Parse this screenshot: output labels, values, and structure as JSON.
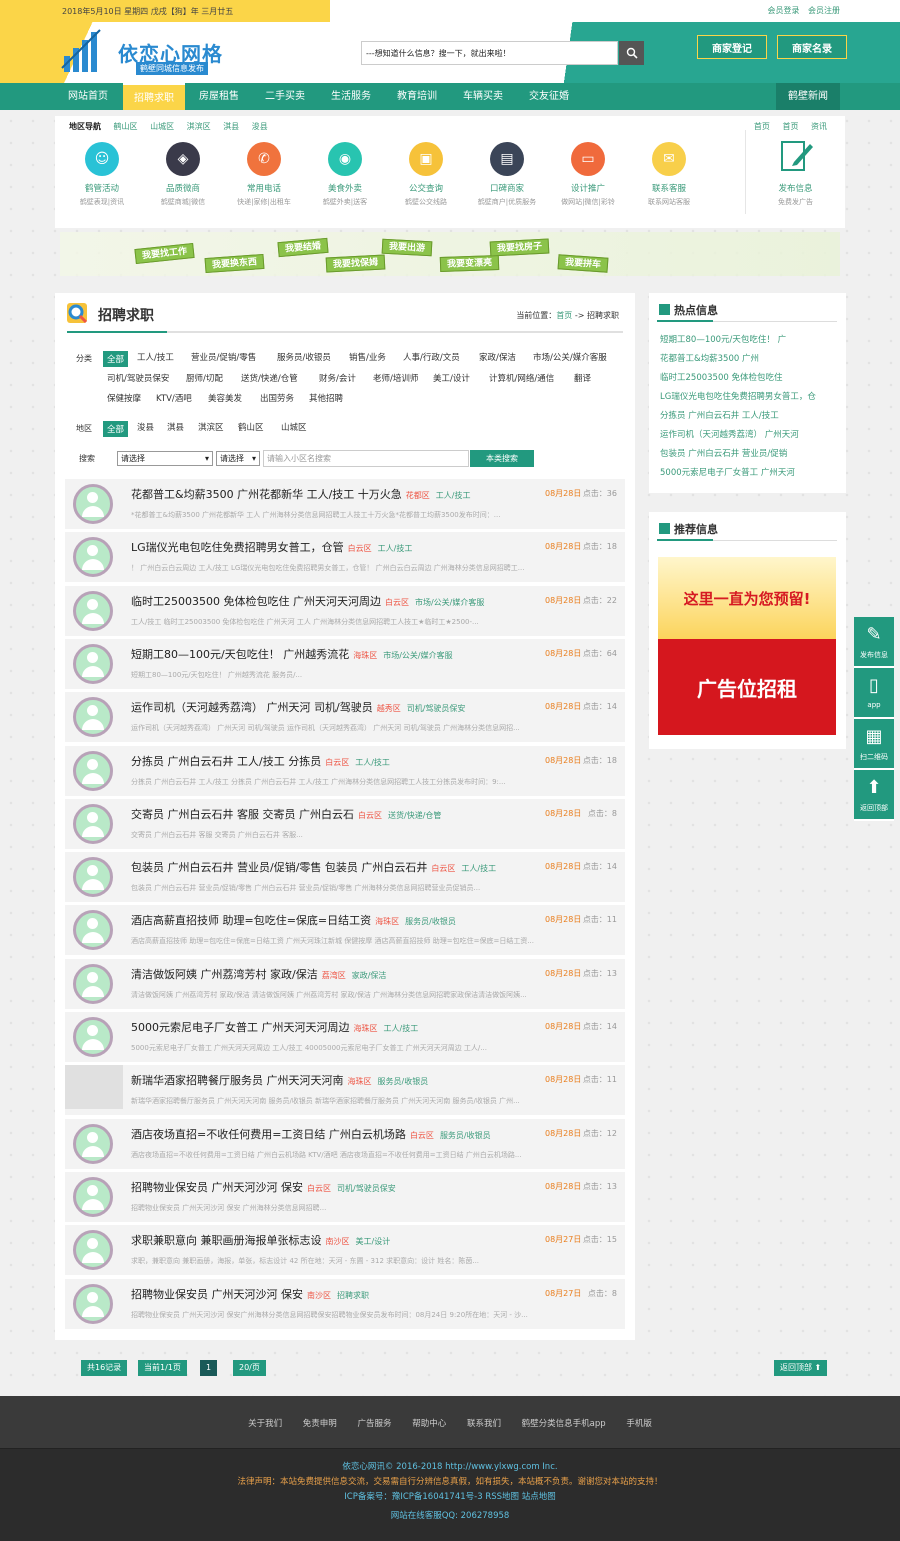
{
  "topbar": {
    "date": "2018年5月10日 星期四 戊戌【狗】年 三月廿五",
    "login": "会员登录",
    "register": "会员注册"
  },
  "logo": {
    "title": "依恋心网格",
    "subtitle": "鹤壁同城信息发布"
  },
  "search": {
    "value": "---想知道什么信息？搜一下，就出来啦！"
  },
  "header_buttons": [
    "商家登记",
    "商家名录"
  ],
  "nav": {
    "items": [
      "网站首页",
      "招聘求职",
      "房屋租售",
      "二手买卖",
      "生活服务",
      "教育培训",
      "车辆买卖",
      "交友征婚"
    ],
    "active": 1,
    "right": "鹤壁新闻"
  },
  "region": {
    "label": "地区导航",
    "items": [
      "鹤山区",
      "山城区",
      "淇滨区",
      "淇县",
      "浚县"
    ],
    "right": [
      "资讯",
      "首页",
      "首页"
    ]
  },
  "categories": [
    {
      "title": "鹤管活动",
      "sub": "鹤壁表现|资讯",
      "color": "#29c2d6",
      "icon": "☺"
    },
    {
      "title": "品质微商",
      "sub": "鹤壁商城|微信",
      "color": "#3a3a4a",
      "icon": "◈"
    },
    {
      "title": "常用电话",
      "sub": "快递|家修|出租车",
      "color": "#f0733d",
      "icon": "✆"
    },
    {
      "title": "美食外卖",
      "sub": "鹤壁外卖|送客",
      "color": "#28c4b0",
      "icon": "◉"
    },
    {
      "title": "公交查询",
      "sub": "鹤壁公交线路",
      "color": "#f6c23a",
      "icon": "▣"
    },
    {
      "title": "口碑商家",
      "sub": "鹤壁商户|优质服务",
      "color": "#3b4558",
      "icon": "▤"
    },
    {
      "title": "设计推广",
      "sub": "做网站|微信|彩铃",
      "color": "#f06a3c",
      "icon": "▭"
    },
    {
      "title": "联系客服",
      "sub": "联系网站客服",
      "color": "#f8cf4a",
      "icon": "✉"
    }
  ],
  "post": {
    "title": "发布信息",
    "sub": "免费发广告"
  },
  "banner": [
    "我要找工作",
    "我要换东西",
    "我要结婚",
    "我要找保姆",
    "我要出游",
    "我要变漂亮",
    "我要找房子",
    "我要拼车"
  ],
  "main": {
    "title": "招聘求职",
    "crumb_label": "当前位置：",
    "crumb_home": "首页",
    "crumb_sep": "->",
    "crumb_current": "招聘求职"
  },
  "filters": {
    "cat_label": "分类",
    "cat_row1": [
      "全部",
      "工人/技工",
      "营业员/促销/零售",
      "服务员/收银员",
      "销售/业务",
      "人事/行政/文员",
      "家政/保洁",
      "市场/公关/媒介客服"
    ],
    "cat_row2": [
      "司机/驾驶员保安",
      "厨师/切配",
      "送货/快递/仓管",
      "财务/会计",
      "老师/培训师",
      "美工/设计",
      "计算机/网络/通信",
      "翻译"
    ],
    "cat_row3": [
      "保健按摩",
      "KTV/酒吧",
      "美容美发",
      "出国劳务",
      "其他招聘"
    ],
    "area_label": "地区",
    "areas": [
      "全部",
      "浚县",
      "淇县",
      "淇滨区",
      "鹤山区",
      "山城区"
    ],
    "search_label": "搜索",
    "select1": "请选择",
    "select2": "请选择",
    "kw_placeholder": "请输入小区名搜索",
    "search_btn": "本类搜索"
  },
  "listings": [
    {
      "title": "花都普工&均薪3500 广州花都新华 工人/技工 十万火急",
      "area": "花都区",
      "cat": "工人/技工",
      "date": "08月28日",
      "hits": "点击：36",
      "desc": "*花都普工&均薪3500 广州花都新华 工人 广州海林分类信息网招聘工人技工十万火急*花都普工均薪3500发布时间：..."
    },
    {
      "title": "LG瑞仪光电包吃住免费招聘男女普工，仓管",
      "area": "白云区",
      "cat": "工人/技工",
      "date": "08月28日",
      "hits": "点击：18",
      "desc": "！ 广州白云白云周边 工人/技工 LG瑞仪光电包吃住免费招聘男女普工，仓管！ 广州白云白云周边 广州海林分类信息网招聘工..."
    },
    {
      "title": "临时工25003500 免体检包吃住 广州天河天河周边",
      "area": "白云区",
      "cat": "市场/公关/媒介客服",
      "date": "08月28日",
      "hits": "点击：22",
      "desc": "工人/技工 临时工25003500 免体检包吃住 广州天河 工人 广州海林分类信息网招聘工人技工★临时工★2500-..."
    },
    {
      "title": "短期工80—100元/天包吃住！ 广州越秀流花",
      "area": "海珠区",
      "cat": "市场/公关/媒介客服",
      "date": "08月28日",
      "hits": "点击：64",
      "desc": "短期工80—100元/天包吃住！ 广州越秀流花 服务员/..."
    },
    {
      "title": "运作司机（天河越秀荔湾） 广州天河 司机/驾驶员",
      "area": "越秀区",
      "cat": "司机/驾驶员保安",
      "date": "08月28日",
      "hits": "点击：14",
      "desc": "运作司机（天河越秀荔湾） 广州天河 司机/驾驶员 运作司机（天河越秀荔湾） 广州天河 司机/驾驶员 广州海林分类信息网招..."
    },
    {
      "title": "分拣员 广州白云石井 工人/技工 分拣员",
      "area": "白云区",
      "cat": "工人/技工",
      "date": "08月28日",
      "hits": "点击：18",
      "desc": "分拣员 广州白云石井 工人/技工 分拣员 广州白云石井 工人/技工 广州海林分类信息网招聘工人技工分拣员发布时间：9:..."
    },
    {
      "title": "交寄员 广州白云石井 客服 交寄员 广州白云石",
      "area": "白云区",
      "cat": "送货/快递/仓管",
      "date": "08月28日",
      "hits": "点击：8",
      "desc": "交寄员 广州白云石井 客服 交寄员 广州白云石井 客服..."
    },
    {
      "title": "包装员 广州白云石井 营业员/促销/零售 包装员 广州白云石井",
      "area": "白云区",
      "cat": "工人/技工",
      "date": "08月28日",
      "hits": "点击：14",
      "desc": "包装员 广州白云石井 营业员/促销/零售 广州白云石井 营业员/促销/零售 广州海林分类信息网招聘营业员促销员..."
    },
    {
      "title": "酒店高薪直招技师 助理=包吃住=保底=日结工资",
      "area": "海珠区",
      "cat": "服务员/收银员",
      "date": "08月28日",
      "hits": "点击：11",
      "desc": "酒店高薪直招技师 助理=包吃住=保底=日结工资 广州天河珠江新城 保健按摩 酒店高薪直招技师 助理=包吃住=保底=日结工资..."
    },
    {
      "title": "清洁做饭阿姨 广州荔湾芳村 家政/保洁",
      "area": "荔湾区",
      "cat": "家政/保洁",
      "date": "08月28日",
      "hits": "点击：13",
      "desc": "清洁做饭阿姨 广州荔湾芳村 家政/保洁 清洁做饭阿姨 广州荔湾芳村 家政/保洁 广州海林分类信息网招聘家政保洁清洁做饭阿姨..."
    },
    {
      "title": "5000元索尼电子厂女普工 广州天河天河周边",
      "area": "海珠区",
      "cat": "工人/技工",
      "date": "08月28日",
      "hits": "点击：14",
      "desc": "5000元索尼电子厂女普工 广州天河天河周边 工人/技工 40005000元索尼电子厂女普工 广州天河天河周边 工人/..."
    },
    {
      "title": "新瑞华酒家招聘餐厅服务员 广州天河天河南",
      "area": "海珠区",
      "cat": "服务员/收银员",
      "date": "08月28日",
      "hits": "点击：11",
      "desc": "新瑞华酒家招聘餐厅服务员 广州天河天河南 服务员/收银员 新瑞华酒家招聘餐厅服务员 广州天河天河南 服务员/收银员 广州..."
    },
    {
      "title": "酒店夜场直招=不收任何费用=工资日结 广州白云机场路",
      "area": "白云区",
      "cat": "服务员/收银员",
      "date": "08月28日",
      "hits": "点击：12",
      "desc": "酒店夜场直招=不收任何费用=工资日结 广州白云机场路 KTV/酒吧 酒店夜场直招=不收任何费用=工资日结 广州白云机场路..."
    },
    {
      "title": "招聘物业保安员 广州天河沙河 保安",
      "area": "白云区",
      "cat": "司机/驾驶员保安",
      "date": "08月28日",
      "hits": "点击：13",
      "desc": "招聘物业保安员 广州天河沙河 保安 广州海林分类信息网招聘..."
    },
    {
      "title": "求职兼职意向 兼职画册海报单张标志设",
      "area": "南沙区",
      "cat": "美工/设计",
      "date": "08月27日",
      "hits": "点击：15",
      "desc": "求职，兼职意向 兼职画册，海报，单张，标志设计 42 所在地：天河 - 东圃 - 312 求职意向：设计 姓名：陈茵..."
    },
    {
      "title": "招聘物业保安员 广州天河沙河 保安",
      "area": "南沙区",
      "cat": "招聘求职",
      "date": "08月27日",
      "hits": "点击：8",
      "desc": "招聘物业保安员 广州天河沙河 保安广州海林分类信息网招聘保安招聘物业保安员发布时间：08月24日 9:20所在地：天河 - 沙..."
    }
  ],
  "hot": {
    "title": "热点信息",
    "items": [
      "短期工80—100元/天包吃住！ 广",
      "花都普工&均薪3500 广州",
      "临时工25003500 免体检包吃住",
      "LG瑞仪光电包吃住免费招聘男女普工，仓",
      "分拣员 广州白云石井 工人/技工",
      "运作司机（天河越秀荔湾） 广州天河",
      "包装员 广州白云石井 营业员/促销",
      "5000元索尼电子厂女普工 广州天河"
    ]
  },
  "recommend": {
    "title": "推荐信息",
    "ad_top": "这里一直为您预留!",
    "ad_bottom": "广告位招租"
  },
  "float": [
    "发布信息",
    "app",
    "扫二维码",
    "返回顶部"
  ],
  "pagination": {
    "total": "共16记录",
    "page": "当前1/1页",
    "current": "1",
    "per": "20/页",
    "back_top": "返回顶部 ⬆"
  },
  "footer": {
    "links": [
      "关于我们",
      "免责申明",
      "广告服务",
      "帮助中心",
      "联系我们",
      "鹤壁分类信息手机app",
      "手机版"
    ],
    "copyright": "依恋心网讯© 2016-2018 http://www.ylxwg.com Inc.",
    "law": "法律声明：本站免费提供信息交流，交易需自行分辨信息真假，如有损失，本站概不负责。谢谢您对本站的支持！",
    "icp": "ICP备案号：豫ICP备16041741号-3   RSS地图 站点地图",
    "qq": "网站在线客服QQ: 206278958"
  }
}
